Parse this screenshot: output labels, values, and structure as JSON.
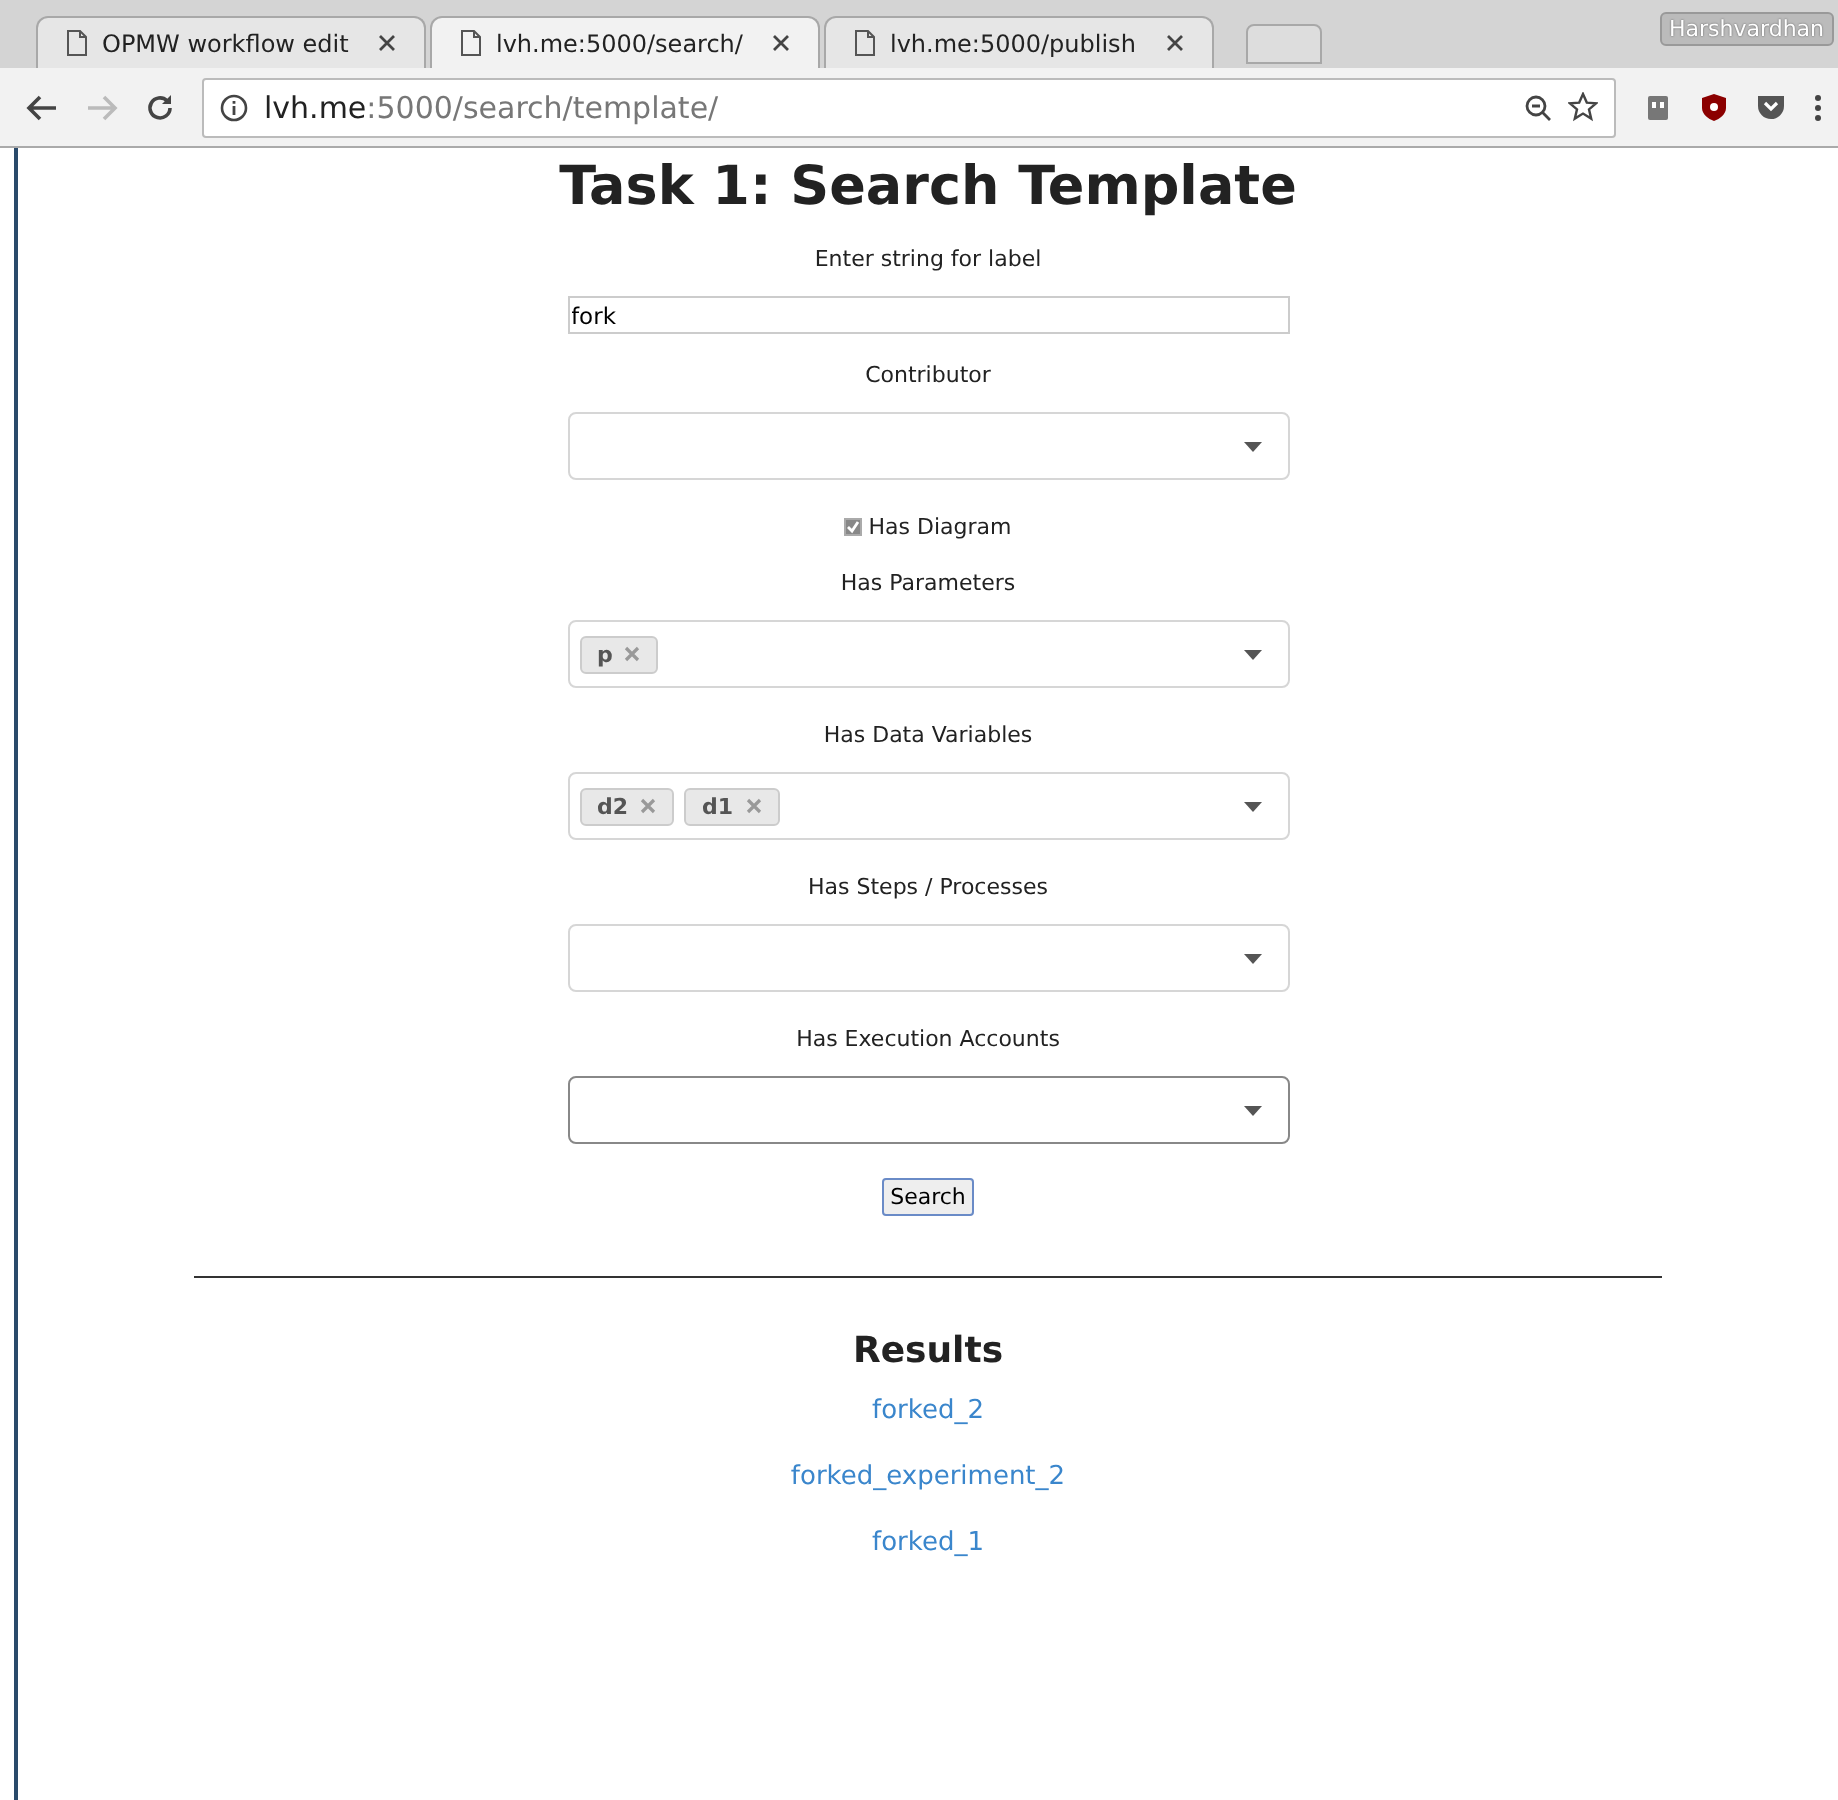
{
  "browser": {
    "tabs": [
      {
        "title": "OPMW workflow edit",
        "selected": false
      },
      {
        "title": "lvh.me:5000/search/",
        "selected": true
      },
      {
        "title": "lvh.me:5000/publish",
        "selected": false
      }
    ],
    "profile": "Harshvardhan",
    "url": {
      "host": "lvh.me",
      "path": ":5000/search/template/"
    }
  },
  "page": {
    "title": "Task 1: Search Template",
    "fields": [
      {
        "kind": "text",
        "label": "Enter string for label",
        "value": "fork"
      },
      {
        "kind": "select",
        "label": "Contributor",
        "focused": false
      },
      {
        "kind": "checkbox",
        "label": "Has Diagram",
        "checked": true
      },
      {
        "kind": "select",
        "label": "Has Parameters",
        "tags": [
          "p"
        ],
        "focused": false
      },
      {
        "kind": "select",
        "label": "Has Data Variables",
        "tags": [
          "d2",
          "d1"
        ],
        "focused": false
      },
      {
        "kind": "select",
        "label": "Has Steps / Processes",
        "focused": false
      },
      {
        "kind": "select",
        "label": "Has Execution Accounts",
        "focused": true
      }
    ],
    "button": "Search",
    "results_title": "Results",
    "results": [
      "forked_2",
      "forked_experiment_2",
      "forked_1"
    ]
  }
}
